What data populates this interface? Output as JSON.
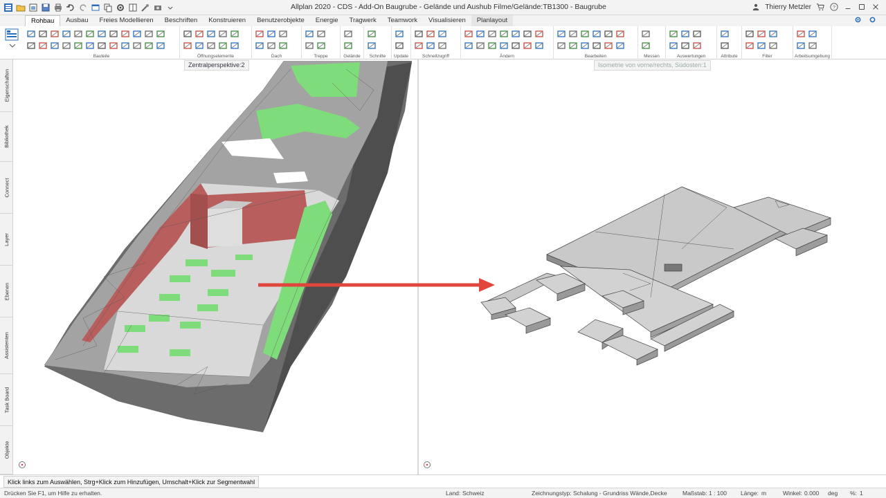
{
  "window": {
    "title": "Allplan 2020 - CDS - Add-On Baugrube - Gelände und Aushub Filme/Gelände:TB1300 - Baugrube",
    "user": "Thierry Metzler"
  },
  "tabs": [
    "Rohbau",
    "Ausbau",
    "Freies Modellieren",
    "Beschriften",
    "Konstruieren",
    "Benutzerobjekte",
    "Energie",
    "Tragwerk",
    "Teamwork",
    "Visualisieren",
    "Planlayout"
  ],
  "ribbon_groups": [
    "Bauteile",
    "Öffnungselemente",
    "Dach",
    "Treppe",
    "Gelände",
    "Schnitte",
    "Update",
    "Schnellzugriff",
    "Ändern",
    "Bearbeiten",
    "Messen",
    "Auswertungen",
    "Attribute",
    "Filter",
    "Arbeitsumgebung"
  ],
  "left_dock": [
    "Eigenschaften",
    "Bibliothek",
    "Connect",
    "Layer",
    "Ebenen",
    "Assistenten",
    "Task Board",
    "Objekte"
  ],
  "viewports": {
    "left_label": "Zentralperspektive:2",
    "right_label": "Isometrie von vorne/rechts, Südosten:1"
  },
  "hint": "Klick links zum Auswählen, Strg+Klick zum Hinzufügen, Umschalt+Klick zur Segmentwahl",
  "status": {
    "help": "Drücken Sie F1, um Hilfe zu erhalten.",
    "land_label": "Land:",
    "land_value": "Schweiz",
    "drawing_type_label": "Zeichnungstyp:",
    "drawing_type_value": "Schalung - Grundriss Wände,Decke",
    "scale_label": "Maßstab:",
    "scale_value": "1 : 100",
    "length_label": "Länge:",
    "length_value": "m",
    "angle_label": "Winkel:",
    "angle_value": "0.000",
    "angle_unit": "deg",
    "percent_label": "%:",
    "percent_value": "1"
  },
  "colors": {
    "accent_blue": "#2a6ebb",
    "terrain_gray": "#9a9a9a",
    "wall_red": "#b85f5e",
    "green": "#7fdc7a",
    "arrow_red": "#e0463e"
  }
}
